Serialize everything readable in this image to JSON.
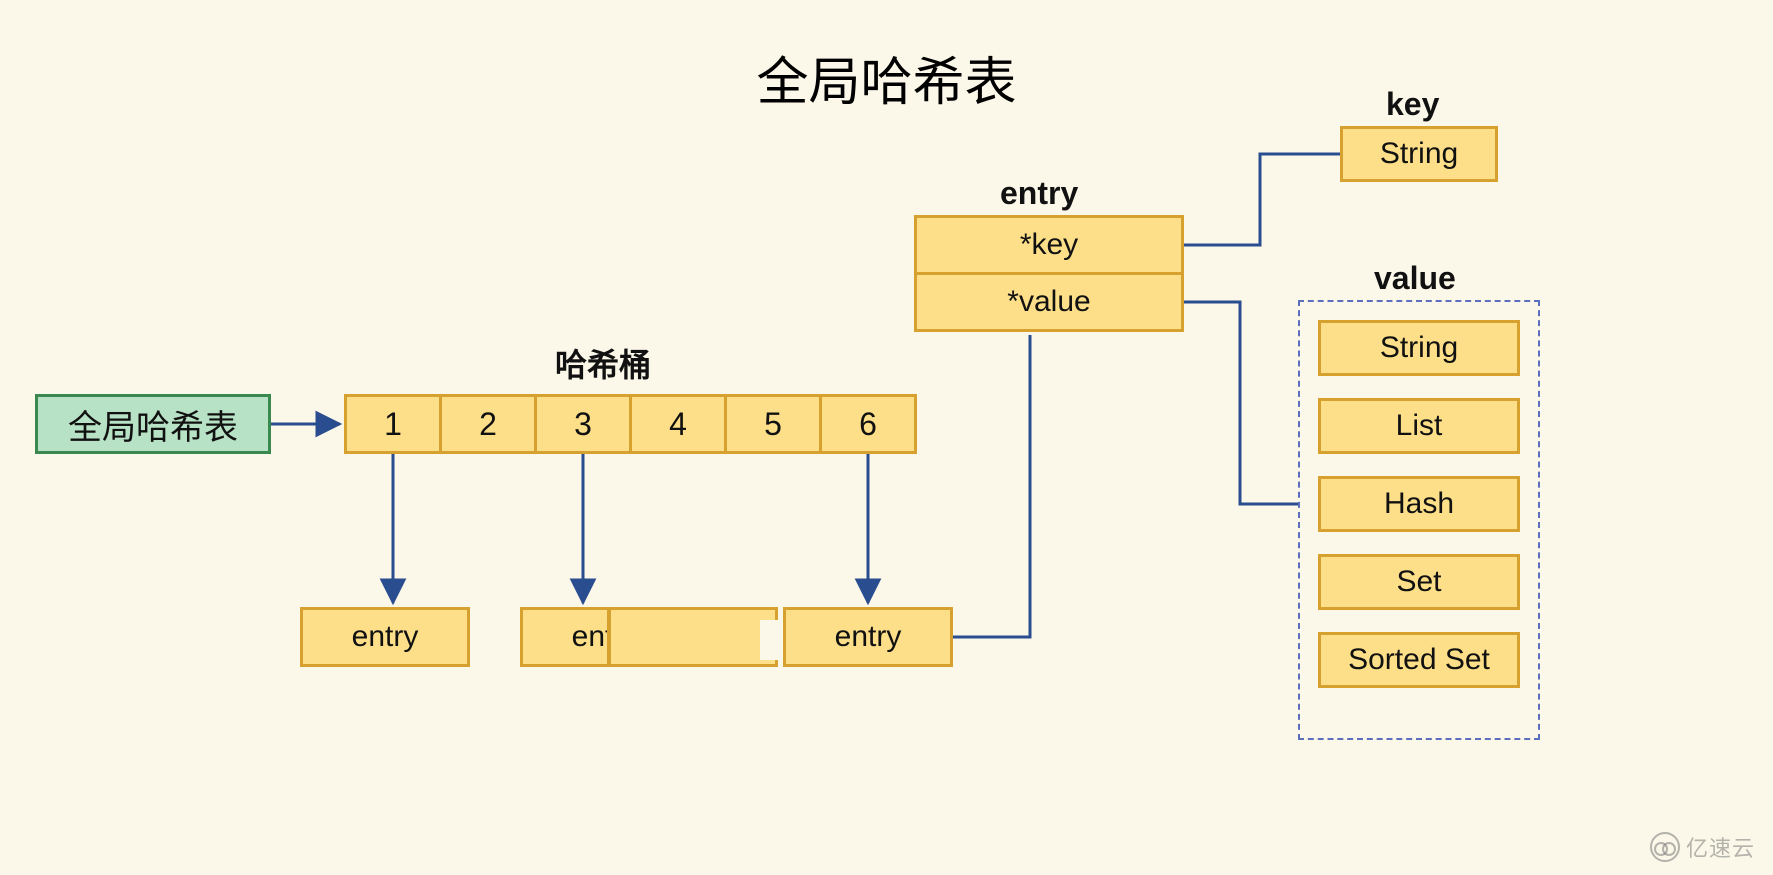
{
  "title": "全局哈希表",
  "global_table_box": "全局哈希表",
  "hash_bucket_label": "哈希桶",
  "buckets": [
    "1",
    "2",
    "3",
    "4",
    "5",
    "6"
  ],
  "entry_labels": {
    "a": "entry",
    "b": "entry",
    "c": "entry"
  },
  "entry_struct_label": "entry",
  "entry_struct": {
    "key": "*key",
    "value": "*value"
  },
  "key_section_label": "key",
  "key_box": "String",
  "value_section_label": "value",
  "value_boxes": [
    "String",
    "List",
    "Hash",
    "Set",
    "Sorted Set"
  ],
  "watermark": "亿速云"
}
